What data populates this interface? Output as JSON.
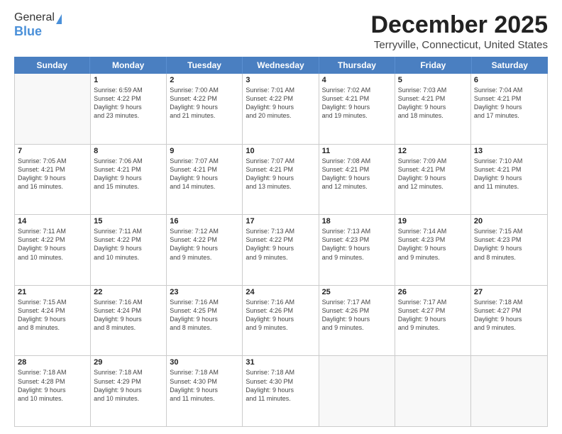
{
  "header": {
    "logo_general": "General",
    "logo_blue": "Blue",
    "month_title": "December 2025",
    "location": "Terryville, Connecticut, United States"
  },
  "weekdays": [
    "Sunday",
    "Monday",
    "Tuesday",
    "Wednesday",
    "Thursday",
    "Friday",
    "Saturday"
  ],
  "rows": [
    [
      {
        "day": "",
        "info": ""
      },
      {
        "day": "1",
        "info": "Sunrise: 6:59 AM\nSunset: 4:22 PM\nDaylight: 9 hours\nand 23 minutes."
      },
      {
        "day": "2",
        "info": "Sunrise: 7:00 AM\nSunset: 4:22 PM\nDaylight: 9 hours\nand 21 minutes."
      },
      {
        "day": "3",
        "info": "Sunrise: 7:01 AM\nSunset: 4:22 PM\nDaylight: 9 hours\nand 20 minutes."
      },
      {
        "day": "4",
        "info": "Sunrise: 7:02 AM\nSunset: 4:21 PM\nDaylight: 9 hours\nand 19 minutes."
      },
      {
        "day": "5",
        "info": "Sunrise: 7:03 AM\nSunset: 4:21 PM\nDaylight: 9 hours\nand 18 minutes."
      },
      {
        "day": "6",
        "info": "Sunrise: 7:04 AM\nSunset: 4:21 PM\nDaylight: 9 hours\nand 17 minutes."
      }
    ],
    [
      {
        "day": "7",
        "info": "Sunrise: 7:05 AM\nSunset: 4:21 PM\nDaylight: 9 hours\nand 16 minutes."
      },
      {
        "day": "8",
        "info": "Sunrise: 7:06 AM\nSunset: 4:21 PM\nDaylight: 9 hours\nand 15 minutes."
      },
      {
        "day": "9",
        "info": "Sunrise: 7:07 AM\nSunset: 4:21 PM\nDaylight: 9 hours\nand 14 minutes."
      },
      {
        "day": "10",
        "info": "Sunrise: 7:07 AM\nSunset: 4:21 PM\nDaylight: 9 hours\nand 13 minutes."
      },
      {
        "day": "11",
        "info": "Sunrise: 7:08 AM\nSunset: 4:21 PM\nDaylight: 9 hours\nand 12 minutes."
      },
      {
        "day": "12",
        "info": "Sunrise: 7:09 AM\nSunset: 4:21 PM\nDaylight: 9 hours\nand 12 minutes."
      },
      {
        "day": "13",
        "info": "Sunrise: 7:10 AM\nSunset: 4:21 PM\nDaylight: 9 hours\nand 11 minutes."
      }
    ],
    [
      {
        "day": "14",
        "info": "Sunrise: 7:11 AM\nSunset: 4:22 PM\nDaylight: 9 hours\nand 10 minutes."
      },
      {
        "day": "15",
        "info": "Sunrise: 7:11 AM\nSunset: 4:22 PM\nDaylight: 9 hours\nand 10 minutes."
      },
      {
        "day": "16",
        "info": "Sunrise: 7:12 AM\nSunset: 4:22 PM\nDaylight: 9 hours\nand 9 minutes."
      },
      {
        "day": "17",
        "info": "Sunrise: 7:13 AM\nSunset: 4:22 PM\nDaylight: 9 hours\nand 9 minutes."
      },
      {
        "day": "18",
        "info": "Sunrise: 7:13 AM\nSunset: 4:23 PM\nDaylight: 9 hours\nand 9 minutes."
      },
      {
        "day": "19",
        "info": "Sunrise: 7:14 AM\nSunset: 4:23 PM\nDaylight: 9 hours\nand 9 minutes."
      },
      {
        "day": "20",
        "info": "Sunrise: 7:15 AM\nSunset: 4:23 PM\nDaylight: 9 hours\nand 8 minutes."
      }
    ],
    [
      {
        "day": "21",
        "info": "Sunrise: 7:15 AM\nSunset: 4:24 PM\nDaylight: 9 hours\nand 8 minutes."
      },
      {
        "day": "22",
        "info": "Sunrise: 7:16 AM\nSunset: 4:24 PM\nDaylight: 9 hours\nand 8 minutes."
      },
      {
        "day": "23",
        "info": "Sunrise: 7:16 AM\nSunset: 4:25 PM\nDaylight: 9 hours\nand 8 minutes."
      },
      {
        "day": "24",
        "info": "Sunrise: 7:16 AM\nSunset: 4:26 PM\nDaylight: 9 hours\nand 9 minutes."
      },
      {
        "day": "25",
        "info": "Sunrise: 7:17 AM\nSunset: 4:26 PM\nDaylight: 9 hours\nand 9 minutes."
      },
      {
        "day": "26",
        "info": "Sunrise: 7:17 AM\nSunset: 4:27 PM\nDaylight: 9 hours\nand 9 minutes."
      },
      {
        "day": "27",
        "info": "Sunrise: 7:18 AM\nSunset: 4:27 PM\nDaylight: 9 hours\nand 9 minutes."
      }
    ],
    [
      {
        "day": "28",
        "info": "Sunrise: 7:18 AM\nSunset: 4:28 PM\nDaylight: 9 hours\nand 10 minutes."
      },
      {
        "day": "29",
        "info": "Sunrise: 7:18 AM\nSunset: 4:29 PM\nDaylight: 9 hours\nand 10 minutes."
      },
      {
        "day": "30",
        "info": "Sunrise: 7:18 AM\nSunset: 4:30 PM\nDaylight: 9 hours\nand 11 minutes."
      },
      {
        "day": "31",
        "info": "Sunrise: 7:18 AM\nSunset: 4:30 PM\nDaylight: 9 hours\nand 11 minutes."
      },
      {
        "day": "",
        "info": ""
      },
      {
        "day": "",
        "info": ""
      },
      {
        "day": "",
        "info": ""
      }
    ]
  ]
}
